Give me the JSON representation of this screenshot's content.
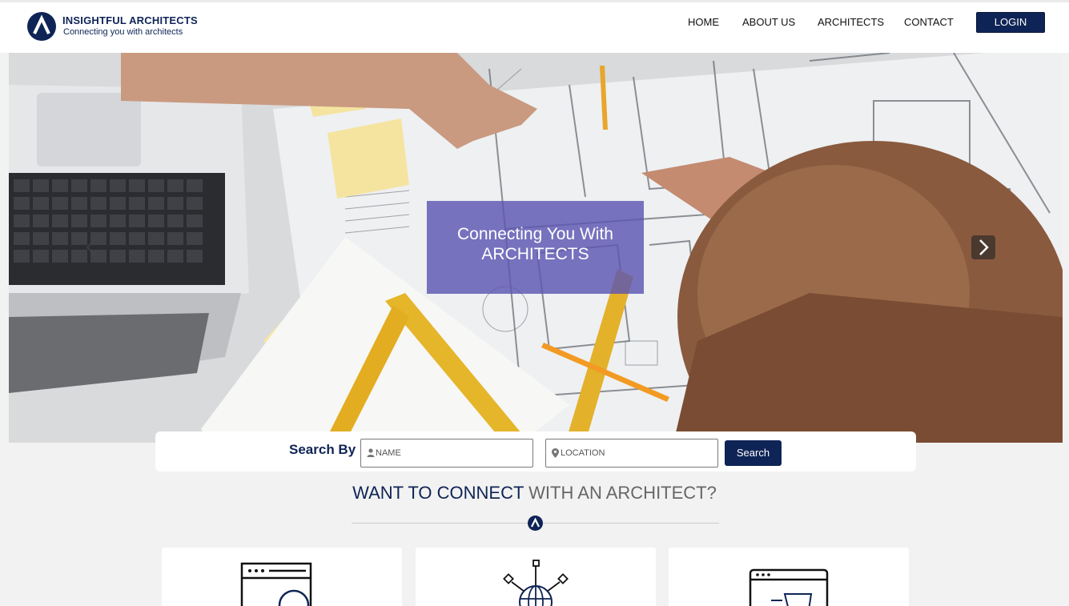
{
  "brand": {
    "name": "INSIGHTFUL ARCHITECTS",
    "tagline": "Connecting you with architects",
    "logo_icon": "logo-icon"
  },
  "nav": {
    "items": [
      {
        "label": "HOME"
      },
      {
        "label": "ABOUT US"
      },
      {
        "label": "ARCHITECTS"
      },
      {
        "label": "CONTACT"
      }
    ],
    "login_label": "LOGIN"
  },
  "hero": {
    "caption_line1": "Connecting You With",
    "caption_line2": "ARCHITECTS",
    "prev_icon": "chevron-left-icon",
    "next_icon": "chevron-right-icon"
  },
  "search": {
    "label": "Search By",
    "name_placeholder": "NAME",
    "location_placeholder": "LOCATION",
    "button_label": "Search",
    "name_icon": "user-icon",
    "location_icon": "map-pin-icon"
  },
  "section": {
    "heading_part1": "WANT TO CONNECT",
    "heading_part2": "WITH AN ARCHITECT?"
  },
  "cards": [
    {
      "icon": "browser-search-icon"
    },
    {
      "icon": "globe-network-icon"
    },
    {
      "icon": "browser-chat-icon"
    }
  ],
  "colors": {
    "brand_navy": "#0f2456",
    "caption_overlay": "#5d56b2",
    "page_background": "#f2f2f2"
  }
}
